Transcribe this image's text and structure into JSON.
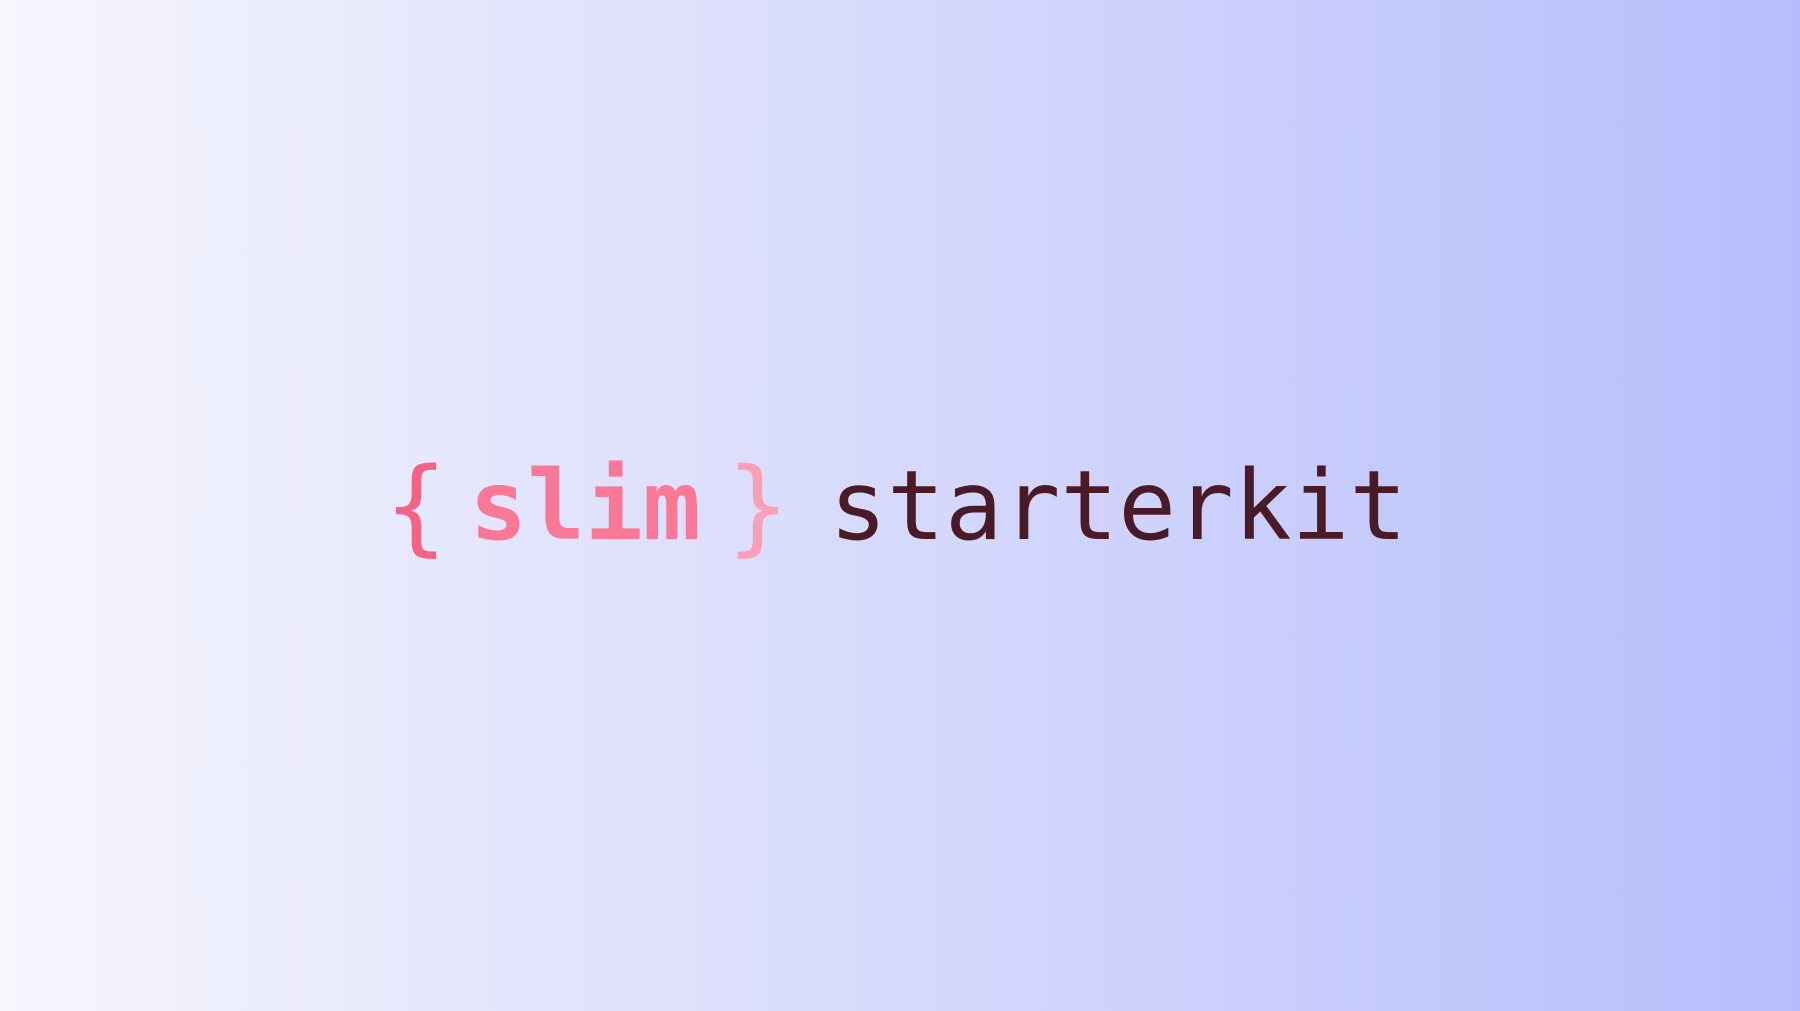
{
  "logo": {
    "brace_open": "{",
    "slim": "slim",
    "brace_close": "}",
    "starterkit": "starterkit"
  },
  "colors": {
    "brace_open": "#f46384",
    "slim": "#f87896",
    "brace_close": "#f9a0b6",
    "starterkit": "#4a1a26",
    "gradient_start": "#f6f7fd",
    "gradient_end": "#b6bdfc"
  }
}
